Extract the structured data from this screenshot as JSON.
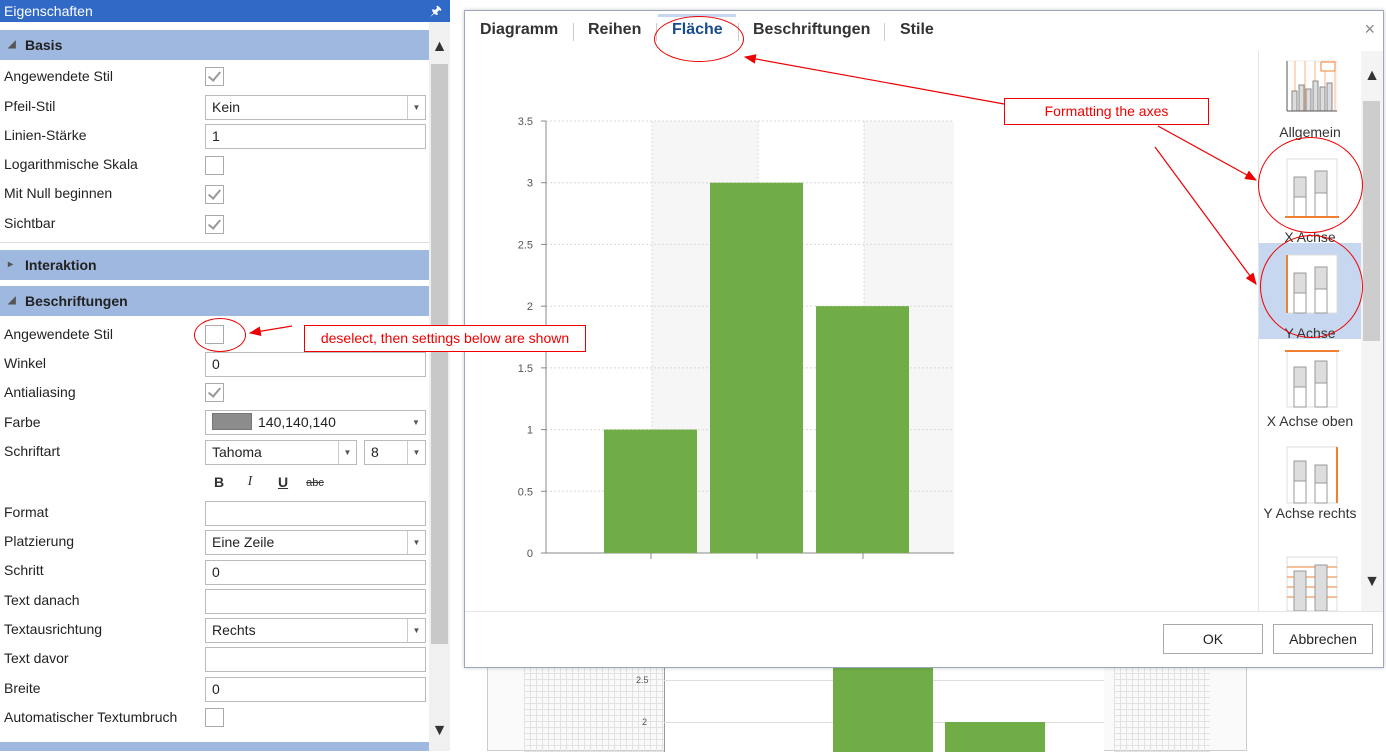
{
  "panel": {
    "title": "Eigenschaften",
    "pin_icon": "pin-icon",
    "sections": {
      "basis": "Basis",
      "interaktion": "Interaktion",
      "beschriftungen": "Beschriftungen"
    },
    "basis": {
      "angewendete_stil": "Angewendete Stil",
      "pfeil_stil": "Pfeil-Stil",
      "pfeil_stil_value": "Kein",
      "linien_staerke": "Linien-Stärke",
      "linien_staerke_value": "1",
      "log_skala": "Logarithmische Skala",
      "mit_null": "Mit Null beginnen",
      "sichtbar": "Sichtbar"
    },
    "beschr": {
      "angewendete_stil": "Angewendete Stil",
      "winkel": "Winkel",
      "winkel_value": "0",
      "antialiasing": "Antialiasing",
      "farbe": "Farbe",
      "farbe_value": "140,140,140",
      "farbe_hex": "#8c8c8c",
      "schriftart": "Schriftart",
      "schriftart_value": "Tahoma",
      "schriftgroesse_value": "8",
      "bold": "B",
      "italic": "I",
      "underline": "U",
      "strike": "abc",
      "format": "Format",
      "format_value": "",
      "platzierung": "Platzierung",
      "platzierung_value": "Eine Zeile",
      "schritt": "Schritt",
      "schritt_value": "0",
      "text_danach": "Text danach",
      "text_danach_value": "",
      "textausrichtung": "Textausrichtung",
      "textausrichtung_value": "Rechts",
      "text_davor": "Text davor",
      "text_davor_value": "",
      "breite": "Breite",
      "breite_value": "0",
      "auto_umbruch": "Automatischer Textumbruch"
    }
  },
  "dialog": {
    "tabs": [
      "Diagramm",
      "Reihen",
      "Fläche",
      "Beschriftungen",
      "Stile"
    ],
    "active_tab": "Fläche",
    "close": "×",
    "sidebar": [
      "Allgemein",
      "X Achse",
      "Y Achse",
      "X Achse oben",
      "Y Achse rechts"
    ],
    "selected_sidebar": "Y Achse",
    "ok": "OK",
    "cancel": "Abbrechen"
  },
  "annotations": {
    "axes": "Formatting the axes",
    "deselect": "deselect, then settings below are shown"
  },
  "background_chart": {
    "ticks": [
      "2.5",
      "2"
    ]
  },
  "chart_data": {
    "type": "bar",
    "categories": [
      "",
      "",
      ""
    ],
    "values": [
      1,
      3,
      2
    ],
    "ylim": [
      0,
      3.5
    ],
    "yticks": [
      "0",
      "0.5",
      "1",
      "1.5",
      "2",
      "2.5",
      "3",
      "3.5"
    ],
    "grid": true,
    "color": "#70ad47"
  }
}
